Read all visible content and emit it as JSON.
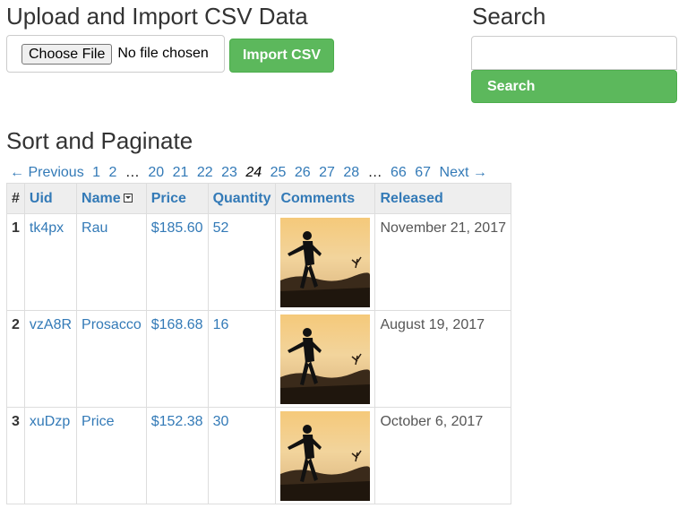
{
  "upload": {
    "title": "Upload and Import CSV Data",
    "choose_file_label": "Choose File",
    "no_file_text": "No file chosen",
    "import_label": "Import CSV"
  },
  "search": {
    "title": "Search",
    "input_value": "",
    "button_label": "Search"
  },
  "sort": {
    "title": "Sort and Paginate"
  },
  "pagination": {
    "previous": "← Previous",
    "next": "Next →",
    "pages": [
      "1",
      "2",
      "…",
      "20",
      "21",
      "22",
      "23",
      "24",
      "25",
      "26",
      "27",
      "28",
      "…",
      "66",
      "67"
    ],
    "current": "24"
  },
  "table": {
    "headers": [
      "#",
      "Uid",
      "Name",
      "Price",
      "Quantity",
      "Comments",
      "Released"
    ],
    "rows": [
      {
        "num": "1",
        "uid": "tk4px",
        "name": "Rau",
        "price": "$185.60",
        "quantity": "52",
        "released": "November 21, 2017"
      },
      {
        "num": "2",
        "uid": "vzA8R",
        "name": "Prosacco",
        "price": "$168.68",
        "quantity": "16",
        "released": "August 19, 2017"
      },
      {
        "num": "3",
        "uid": "xuDzp",
        "name": "Price",
        "price": "$152.38",
        "quantity": "30",
        "released": "October 6, 2017"
      }
    ]
  },
  "colors": {
    "accent_green": "#5cb85c",
    "link_blue": "#337ab7",
    "header_gray": "#eeeeee"
  }
}
